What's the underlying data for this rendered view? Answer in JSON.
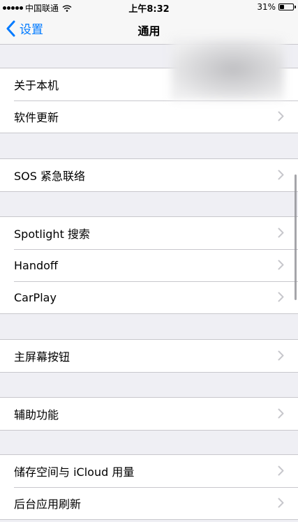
{
  "status_bar": {
    "carrier": "中国联通",
    "time": "上午8:32",
    "battery": "31%",
    "battery_level": 0.31
  },
  "nav": {
    "back_label": "设置",
    "title": "通用"
  },
  "groups": [
    {
      "items": [
        {
          "label": "关于本机"
        },
        {
          "label": "软件更新"
        }
      ]
    },
    {
      "items": [
        {
          "label": "SOS 紧急联络"
        }
      ]
    },
    {
      "items": [
        {
          "label": "Spotlight 搜索"
        },
        {
          "label": "Handoff"
        },
        {
          "label": "CarPlay"
        }
      ]
    },
    {
      "items": [
        {
          "label": "主屏幕按钮"
        }
      ]
    },
    {
      "items": [
        {
          "label": "辅助功能"
        }
      ]
    },
    {
      "items": [
        {
          "label": "储存空间与 iCloud 用量"
        },
        {
          "label": "后台应用刷新"
        }
      ]
    }
  ],
  "icons": {
    "back": "chevron-left-icon",
    "row_chevron": "chevron-right-icon",
    "wifi": "wifi-icon",
    "battery": "battery-icon"
  },
  "colors": {
    "accent": "#007aff",
    "background": "#efeff4",
    "separator": "#c8c7cc",
    "chevron": "#c7c7cc"
  }
}
